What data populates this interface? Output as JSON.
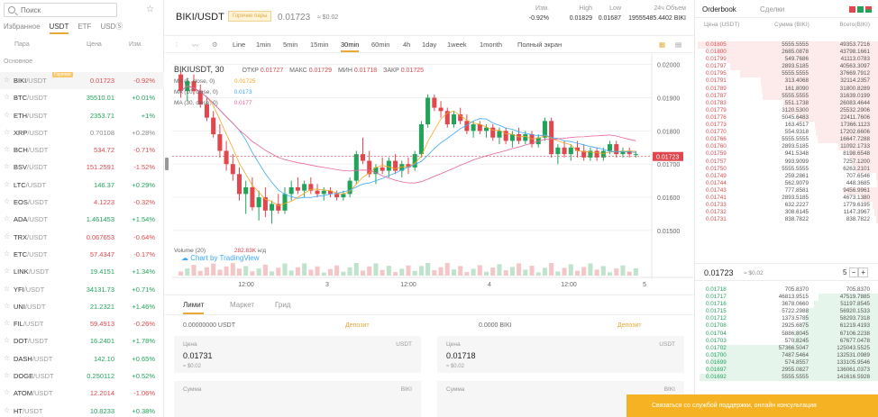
{
  "markets": {
    "search_placeholder": "Поиск",
    "tabs": [
      "Избранное",
      "USDT",
      "ETF",
      "USDⓈ"
    ],
    "active_tab": 1,
    "headers": {
      "pair": "Пара",
      "price": "Цена",
      "change": "Изм."
    },
    "section": "Основное",
    "hot_label": "Горячие",
    "rows": [
      {
        "base": "BIKI",
        "quote": "/USDT",
        "price": "0.01723",
        "change": "-0.92%",
        "dir": "dn",
        "sel": true
      },
      {
        "base": "BTC",
        "quote": "/USDT",
        "price": "35510.01",
        "change": "+0.01%",
        "dir": "up"
      },
      {
        "base": "ETH",
        "quote": "/USDT",
        "price": "2353.71",
        "change": "+1%",
        "dir": "up"
      },
      {
        "base": "XRP",
        "quote": "/USDT",
        "price": "0.70108",
        "change": "+0.28%",
        "dir": "nt"
      },
      {
        "base": "BCH",
        "quote": "/USDT",
        "price": "534.72",
        "change": "-0.71%",
        "dir": "dn"
      },
      {
        "base": "BSV",
        "quote": "/USDT",
        "price": "151.2591",
        "change": "-1.52%",
        "dir": "dn"
      },
      {
        "base": "LTC",
        "quote": "/USDT",
        "price": "146.37",
        "change": "+0.29%",
        "dir": "up"
      },
      {
        "base": "EOS",
        "quote": "/USDT",
        "price": "4.1223",
        "change": "-0.32%",
        "dir": "dn"
      },
      {
        "base": "ADA",
        "quote": "/USDT",
        "price": "1.461453",
        "change": "+1.54%",
        "dir": "up"
      },
      {
        "base": "TRX",
        "quote": "/USDT",
        "price": "0.067653",
        "change": "-0.64%",
        "dir": "dn"
      },
      {
        "base": "ETC",
        "quote": "/USDT",
        "price": "57.4347",
        "change": "-0.17%",
        "dir": "dn"
      },
      {
        "base": "LINK",
        "quote": "/USDT",
        "price": "19.4151",
        "change": "+1.34%",
        "dir": "up"
      },
      {
        "base": "YFI",
        "quote": "/USDT",
        "price": "34131.73",
        "change": "+0.71%",
        "dir": "up"
      },
      {
        "base": "UNI",
        "quote": "/USDT",
        "price": "21.2321",
        "change": "+1.46%",
        "dir": "up"
      },
      {
        "base": "FIL",
        "quote": "/USDT",
        "price": "59.4913",
        "change": "-0.26%",
        "dir": "dn"
      },
      {
        "base": "DOT",
        "quote": "/USDT",
        "price": "16.2401",
        "change": "+1.78%",
        "dir": "up"
      },
      {
        "base": "DASH",
        "quote": "/USDT",
        "price": "142.10",
        "change": "+0.65%",
        "dir": "up"
      },
      {
        "base": "DOGE",
        "quote": "/USDT",
        "price": "0.250112",
        "change": "+0.52%",
        "dir": "up"
      },
      {
        "base": "ATOM",
        "quote": "/USDT",
        "price": "12.2014",
        "change": "-1.06%",
        "dir": "dn"
      },
      {
        "base": "HT",
        "quote": "/USDT",
        "price": "10.8233",
        "change": "+0.38%",
        "dir": "up"
      }
    ]
  },
  "ticker": {
    "symbol": "BIKI/USDT",
    "badge": "Горячие пары",
    "last": "0.01723",
    "last_usd": "≈ $0.02",
    "stats": [
      {
        "label": "Изм.",
        "value": "-0.92%",
        "dir": "dn"
      },
      {
        "label": "High",
        "value": "0.01829",
        "dir": ""
      },
      {
        "label": "Low",
        "value": "0.01687",
        "dir": ""
      },
      {
        "label": "24ч Объем",
        "value": "19555485.4402 BIKI",
        "dir": ""
      }
    ]
  },
  "chart_toolbar": {
    "intervals": [
      "Line",
      "1min",
      "5min",
      "15min",
      "30min",
      "60min",
      "4h",
      "1day",
      "1week",
      "1month",
      "Полный экран"
    ],
    "active": "30min"
  },
  "chart": {
    "title": "BIKIUSDT, 30",
    "ohlc": {
      "open_label": "ОТКР",
      "open": "0.01727",
      "high_label": "МАКС",
      "high": "0.01729",
      "low_label": "МИН",
      "low": "0.01718",
      "close_label": "ЗАКР",
      "close": "0.01725"
    },
    "ma": [
      {
        "label": "MA (5, close, 0)",
        "value": "0.01725",
        "color": "#f5a623"
      },
      {
        "label": "MA (10, close, 0)",
        "value": "0.0173",
        "color": "#3fa9f5"
      },
      {
        "label": "MA (30, close, 0)",
        "value": "0.0177",
        "color": "#e8649b"
      }
    ],
    "volume_label": "Volume (20)",
    "volume_value": "282.83K",
    "volume_na": "н/д",
    "watermark": "Chart by TradingView",
    "price_tag": "0.01723",
    "y_labels": [
      "0.01900",
      "0.01800",
      "0.01700",
      "0.01600",
      "0.01500"
    ],
    "top_label": "0.02000",
    "x_labels": [
      "12:00",
      "3",
      "12:00",
      "4",
      "12:00",
      "5"
    ]
  },
  "chart_data": {
    "type": "candlestick",
    "ylim": [
      0.0144,
      0.0201
    ],
    "candles": [
      [
        0.0197,
        0.0198,
        0.019,
        0.0192
      ],
      [
        0.0192,
        0.0196,
        0.0189,
        0.0195
      ],
      [
        0.0195,
        0.0197,
        0.0191,
        0.0192
      ],
      [
        0.0192,
        0.0194,
        0.0187,
        0.0188
      ],
      [
        0.0188,
        0.019,
        0.0183,
        0.0184
      ],
      [
        0.0184,
        0.0186,
        0.0178,
        0.0179
      ],
      [
        0.0179,
        0.0182,
        0.0172,
        0.0174
      ],
      [
        0.0174,
        0.0177,
        0.0168,
        0.017
      ],
      [
        0.017,
        0.0173,
        0.0165,
        0.0167
      ],
      [
        0.0167,
        0.0169,
        0.0159,
        0.0161
      ],
      [
        0.0161,
        0.0165,
        0.0155,
        0.0163
      ],
      [
        0.0163,
        0.0166,
        0.0156,
        0.0157
      ],
      [
        0.0157,
        0.0162,
        0.0153,
        0.016
      ],
      [
        0.016,
        0.0163,
        0.0154,
        0.0156
      ],
      [
        0.0156,
        0.0159,
        0.0152,
        0.0158
      ],
      [
        0.0158,
        0.0161,
        0.0155,
        0.0156
      ],
      [
        0.0156,
        0.0163,
        0.0155,
        0.0161
      ],
      [
        0.0161,
        0.0165,
        0.0159,
        0.0163
      ],
      [
        0.0163,
        0.0166,
        0.0161,
        0.0162
      ],
      [
        0.0162,
        0.0165,
        0.016,
        0.0164
      ],
      [
        0.0164,
        0.0166,
        0.0161,
        0.0162
      ],
      [
        0.0162,
        0.0164,
        0.016,
        0.0161
      ],
      [
        0.0161,
        0.0163,
        0.0159,
        0.0162
      ],
      [
        0.0162,
        0.0163,
        0.016,
        0.0161
      ],
      [
        0.0161,
        0.0162,
        0.0159,
        0.016
      ],
      [
        0.016,
        0.0162,
        0.0159,
        0.0161
      ],
      [
        0.0161,
        0.0166,
        0.016,
        0.0165
      ],
      [
        0.0165,
        0.0174,
        0.0164,
        0.0173
      ],
      [
        0.0173,
        0.0178,
        0.017,
        0.0171
      ],
      [
        0.0171,
        0.0174,
        0.0166,
        0.0167
      ],
      [
        0.0167,
        0.017,
        0.0164,
        0.0169
      ],
      [
        0.0169,
        0.0172,
        0.0167,
        0.0168
      ],
      [
        0.0168,
        0.0172,
        0.0166,
        0.0171
      ],
      [
        0.0171,
        0.0173,
        0.0167,
        0.0168
      ],
      [
        0.0168,
        0.0171,
        0.0166,
        0.017
      ],
      [
        0.017,
        0.0172,
        0.0167,
        0.0169
      ],
      [
        0.0169,
        0.0174,
        0.0168,
        0.0173
      ],
      [
        0.0173,
        0.0183,
        0.0172,
        0.0182
      ],
      [
        0.0182,
        0.0191,
        0.0181,
        0.019
      ],
      [
        0.019,
        0.0191,
        0.0186,
        0.0187
      ],
      [
        0.0187,
        0.0189,
        0.0184,
        0.0186
      ],
      [
        0.0186,
        0.0187,
        0.0181,
        0.0182
      ],
      [
        0.0182,
        0.0186,
        0.0181,
        0.0185
      ],
      [
        0.0185,
        0.0187,
        0.0182,
        0.0183
      ],
      [
        0.0183,
        0.0185,
        0.0179,
        0.018
      ],
      [
        0.018,
        0.0183,
        0.0178,
        0.0182
      ],
      [
        0.0182,
        0.0183,
        0.0179,
        0.018
      ],
      [
        0.018,
        0.0182,
        0.0178,
        0.0181
      ],
      [
        0.0181,
        0.0182,
        0.0177,
        0.0178
      ],
      [
        0.0178,
        0.0181,
        0.0176,
        0.018
      ],
      [
        0.018,
        0.0181,
        0.0176,
        0.0177
      ],
      [
        0.0177,
        0.018,
        0.0175,
        0.0179
      ],
      [
        0.0179,
        0.0181,
        0.0176,
        0.0177
      ],
      [
        0.0177,
        0.018,
        0.0176,
        0.0179
      ],
      [
        0.0179,
        0.018,
        0.0175,
        0.0176
      ],
      [
        0.0176,
        0.0179,
        0.0175,
        0.0178
      ],
      [
        0.0178,
        0.0184,
        0.0177,
        0.0183
      ],
      [
        0.0183,
        0.0184,
        0.0172,
        0.0173
      ],
      [
        0.0173,
        0.0176,
        0.017,
        0.0175
      ],
      [
        0.0175,
        0.0177,
        0.0172,
        0.0173
      ],
      [
        0.0173,
        0.0176,
        0.0171,
        0.0175
      ],
      [
        0.0175,
        0.0177,
        0.0172,
        0.0174
      ],
      [
        0.0174,
        0.0176,
        0.0171,
        0.0172
      ],
      [
        0.0172,
        0.0175,
        0.0171,
        0.0174
      ],
      [
        0.0174,
        0.0175,
        0.0171,
        0.0172
      ],
      [
        0.0172,
        0.0175,
        0.0171,
        0.0174
      ],
      [
        0.0174,
        0.0177,
        0.0173,
        0.0176
      ],
      [
        0.0176,
        0.0177,
        0.0172,
        0.0173
      ],
      [
        0.0173,
        0.0175,
        0.0172,
        0.0174
      ],
      [
        0.0174,
        0.0175,
        0.0172,
        0.0173
      ],
      [
        0.0173,
        0.0174,
        0.0172,
        0.0173
      ]
    ],
    "current_price": 0.01723
  },
  "form": {
    "tabs": [
      "Лимит",
      "Маркет",
      "Грид"
    ],
    "buy": {
      "balance": "0.00000000 USDT",
      "deposit": "Депозит",
      "price_label": "Цена",
      "price_currency": "USDT",
      "price": "0.01731",
      "price_usd": "≈ $0.02",
      "amount_label": "Сумма",
      "amount_currency": "BIKI"
    },
    "sell": {
      "balance": "0.0000 BIKI",
      "deposit": "Депозит",
      "price_label": "Цена",
      "price_currency": "USDT",
      "price": "0.01718",
      "price_usd": "≈ $0.02",
      "amount_label": "Сумма",
      "amount_currency": "BIKI"
    }
  },
  "orderbook": {
    "tabs": [
      "Orderbook",
      "Сделки"
    ],
    "headers": {
      "price": "Цена (USDT)",
      "amount": "Сумма (BIKI)",
      "total": "Всего(BIKI)"
    },
    "asks": [
      [
        "0.01805",
        "5555.5555",
        "49353.7216"
      ],
      [
        "0.01800",
        "2685.0878",
        "43798.1661"
      ],
      [
        "0.01799",
        "549.7686",
        "41113.0783"
      ],
      [
        "0.01797",
        "2893.5185",
        "40563.3097"
      ],
      [
        "0.01795",
        "5555.5555",
        "37669.7912"
      ],
      [
        "0.01791",
        "313.4068",
        "32114.2357"
      ],
      [
        "0.01789",
        "161.8090",
        "31800.8289"
      ],
      [
        "0.01787",
        "5555.5555",
        "31639.0199"
      ],
      [
        "0.01783",
        "551.1738",
        "26083.4644"
      ],
      [
        "0.01779",
        "3120.5300",
        "25532.2906"
      ],
      [
        "0.01776",
        "5045.6483",
        "22411.7606"
      ],
      [
        "0.01773",
        "163.4517",
        "17366.1123"
      ],
      [
        "0.01770",
        "554.9318",
        "17202.6606"
      ],
      [
        "0.01766",
        "5555.5555",
        "16647.7288"
      ],
      [
        "0.01760",
        "2893.5185",
        "11092.1733"
      ],
      [
        "0.01759",
        "941.5348",
        "8198.6548"
      ],
      [
        "0.01757",
        "993.9099",
        "7257.1200"
      ],
      [
        "0.01750",
        "5555.5555",
        "6263.2101"
      ],
      [
        "0.01749",
        "259.2861",
        "707.6546"
      ],
      [
        "0.01744",
        "562.9079",
        "448.3685"
      ],
      [
        "0.01743",
        "777.8581",
        "9456.9961"
      ],
      [
        "0.01741",
        "2893.5185",
        "4673.1380"
      ],
      [
        "0.01733",
        "632.2227",
        "1779.6195"
      ],
      [
        "0.01732",
        "308.6145",
        "1147.3967"
      ],
      [
        "0.01731",
        "838.7822",
        "838.7822"
      ]
    ],
    "mid_price": "0.01723",
    "mid_usd": "≈ $0.02",
    "decimals": "5",
    "bids": [
      [
        "0.01718",
        "705.8370",
        "705.8370"
      ],
      [
        "0.01717",
        "46813.9515",
        "47519.7885"
      ],
      [
        "0.01716",
        "3678.0660",
        "51197.8545"
      ],
      [
        "0.01715",
        "5722.2988",
        "56920.1533"
      ],
      [
        "0.01712",
        "1373.5785",
        "58293.7318"
      ],
      [
        "0.01708",
        "2925.6875",
        "61219.4193"
      ],
      [
        "0.01704",
        "5886.8045",
        "67106.2238"
      ],
      [
        "0.01703",
        "570.8245",
        "67677.0478"
      ],
      [
        "0.01702",
        "57366.5047",
        "125043.5525"
      ],
      [
        "0.01700",
        "7487.5464",
        "132531.0989"
      ],
      [
        "0.01699",
        "574.8557",
        "133105.9546"
      ],
      [
        "0.01697",
        "2955.0827",
        "136061.0373"
      ],
      [
        "0.01692",
        "5555.5555",
        "141616.5928"
      ]
    ]
  },
  "notice": "Связаться со службой поддержки, онлайн консультация",
  "colors": {
    "up": "#22a35a",
    "down": "#e0484e",
    "accent": "#e8a93a"
  }
}
